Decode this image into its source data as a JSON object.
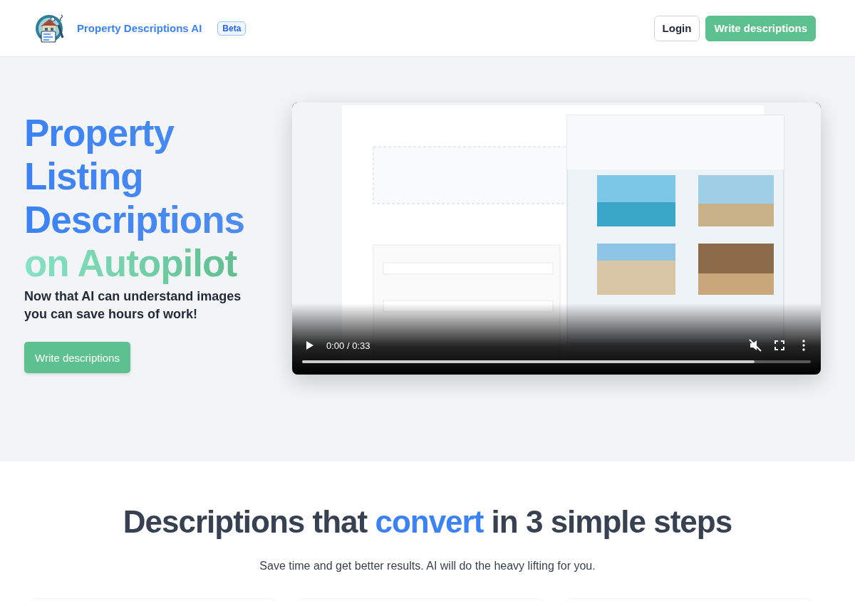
{
  "header": {
    "brand": "Property Descriptions AI",
    "badge": "Beta",
    "buttons": [
      {
        "label": "Login",
        "kind": "outline"
      },
      {
        "label": "Write descriptions",
        "kind": "primary"
      }
    ]
  },
  "hero": {
    "title_main": "Property Listing Descriptions",
    "title_accent": "on Autopilot",
    "subtitle": "Now that AI can understand images you can save hours of work!",
    "button": "Write descriptions",
    "video": {
      "time": "0:00 / 0:33",
      "muted": true,
      "progress": {
        "level": 0.89
      }
    }
  },
  "steps": {
    "heading_before": "Descriptions that",
    "heading_accent": "convert",
    "heading_after": "in 3 simple steps",
    "subtitle": "Save time and get better results. AI will do the heavy lifting for you."
  }
}
